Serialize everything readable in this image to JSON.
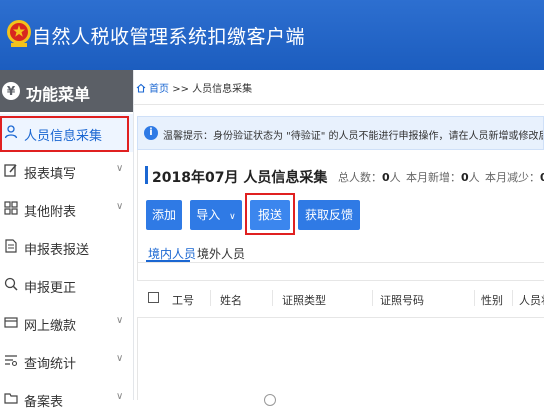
{
  "app": {
    "title": "自然人税收管理系统扣缴客户端"
  },
  "sidebar": {
    "header": "功能菜单",
    "items": [
      {
        "label": "人员信息采集",
        "icon": "person-icon",
        "active": true,
        "chevron": false
      },
      {
        "label": "报表填写",
        "icon": "edit-icon",
        "active": false,
        "chevron": true
      },
      {
        "label": "其他附表",
        "icon": "grid-icon",
        "active": false,
        "chevron": true
      },
      {
        "label": "申报表报送",
        "icon": "document-icon",
        "active": false,
        "chevron": false
      },
      {
        "label": "申报更正",
        "icon": "search-icon",
        "active": false,
        "chevron": false
      },
      {
        "label": "网上缴款",
        "icon": "wallet-icon",
        "active": false,
        "chevron": true
      },
      {
        "label": "查询统计",
        "icon": "list-icon",
        "active": false,
        "chevron": true
      },
      {
        "label": "备案表",
        "icon": "folder-icon",
        "active": false,
        "chevron": true
      }
    ]
  },
  "breadcrumb": {
    "home": "首页",
    "separator": ">>",
    "current": "人员信息采集"
  },
  "notice": {
    "prefix": "温馨提示：",
    "text": "身份验证状态为 \"待验证\" 的人员不能进行申报操作，请在人员新增或修改后及时 \"报送登记"
  },
  "page": {
    "title": "2018年07月  人员信息采集",
    "stats": [
      {
        "label": "总人数：",
        "value": "0",
        "unit": "人"
      },
      {
        "label": "本月新增：",
        "value": "0",
        "unit": "人"
      },
      {
        "label": "本月减少：",
        "value": "0",
        "unit": "人"
      }
    ]
  },
  "toolbar": {
    "add_label": "添加",
    "import_label": "导入",
    "import_chevron": "∨",
    "submit_label": "报送",
    "feedback_label": "获取反馈"
  },
  "tabs": [
    {
      "label": "境内人员",
      "active": true
    },
    {
      "label": "境外人员",
      "active": false
    }
  ],
  "table": {
    "columns": [
      "工号",
      "姓名",
      "证照类型",
      "证照号码",
      "性别",
      "人员状"
    ]
  },
  "colors": {
    "header": "#1c5dbf",
    "accent": "#2f7ae5",
    "highlight": "#e02020"
  }
}
